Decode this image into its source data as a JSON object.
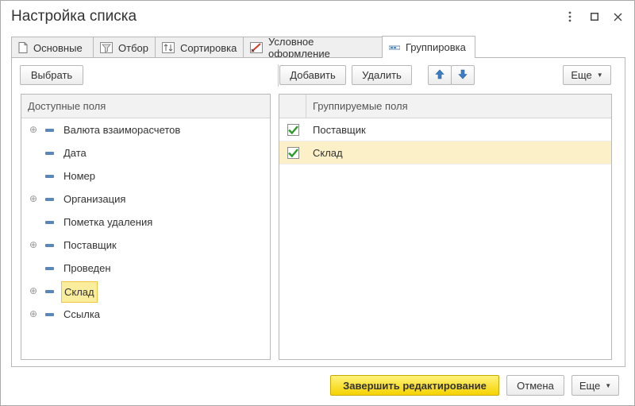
{
  "window": {
    "title": "Настройка списка"
  },
  "tabs": [
    {
      "label": "Основные",
      "icon": "document-icon"
    },
    {
      "label": "Отбор",
      "icon": "filter-icon"
    },
    {
      "label": "Сортировка",
      "icon": "sort-icon"
    },
    {
      "label": "Условное оформление",
      "icon": "conditional-format-icon"
    },
    {
      "label": "Группировка",
      "icon": "grouping-icon",
      "active": true
    }
  ],
  "toolbar": {
    "select_label": "Выбрать",
    "add_label": "Добавить",
    "delete_label": "Удалить",
    "more_label": "Еще"
  },
  "available_fields": {
    "header": "Доступные поля",
    "items": [
      {
        "label": "Валюта взаиморасчетов",
        "expandable": true
      },
      {
        "label": "Дата",
        "expandable": false
      },
      {
        "label": "Номер",
        "expandable": false
      },
      {
        "label": "Организация",
        "expandable": true
      },
      {
        "label": "Пометка удаления",
        "expandable": false
      },
      {
        "label": "Поставщик",
        "expandable": true
      },
      {
        "label": "Проведен",
        "expandable": false
      },
      {
        "label": "Склад",
        "expandable": true,
        "selected": true
      },
      {
        "label": "Ссылка",
        "expandable": true
      }
    ]
  },
  "grouped_fields": {
    "header": "Группируемые поля",
    "rows": [
      {
        "label": "Поставщик",
        "checked": true
      },
      {
        "label": "Склад",
        "checked": true,
        "selected": true
      }
    ]
  },
  "footer": {
    "finish_label": "Завершить редактирование",
    "cancel_label": "Отмена",
    "more_label": "Еще"
  },
  "colors": {
    "primary_button": "#f5d300",
    "selection": "#fbed9e",
    "check_green": "#2e9a2e",
    "field_icon": "#5a87b9",
    "arrow_blue": "#3b7dc4"
  }
}
